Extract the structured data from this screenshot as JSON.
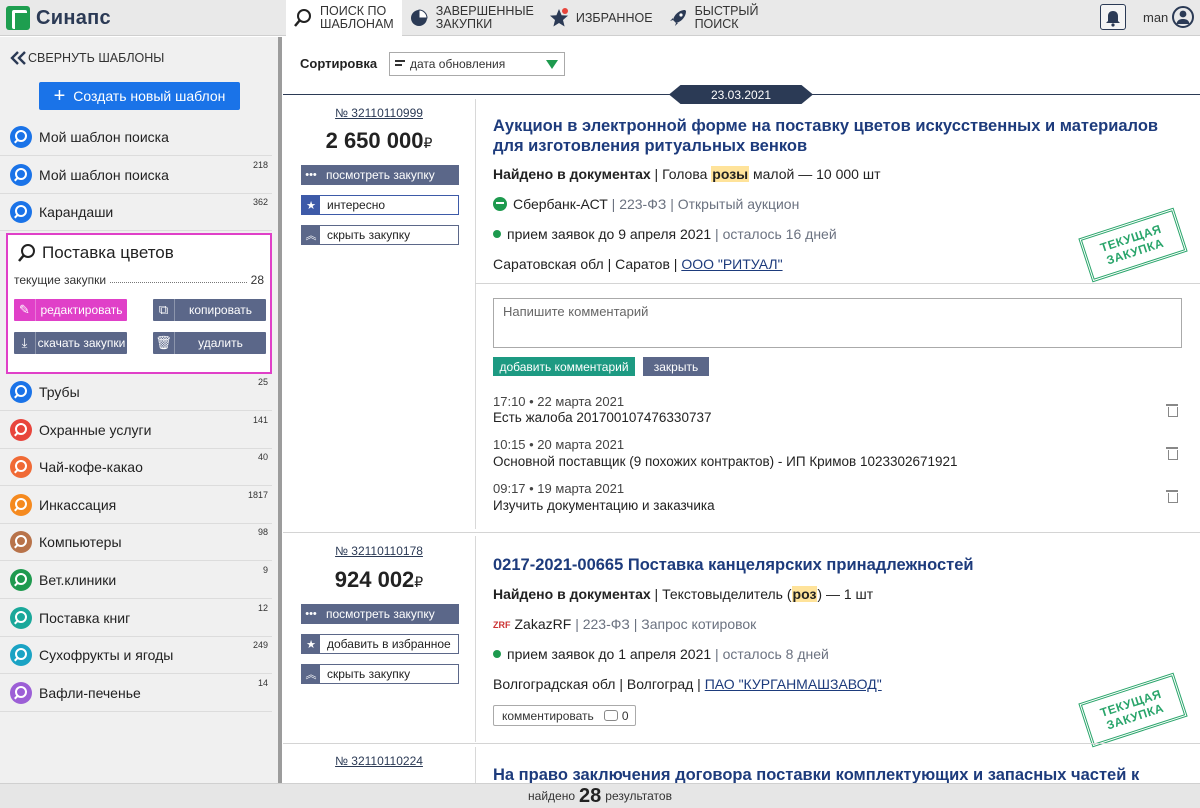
{
  "app": {
    "name": "Синапс",
    "user": "man"
  },
  "nav": [
    {
      "label": "Поиск по\nшаблонам",
      "icon": "search-icon"
    },
    {
      "label": "Завершенные\nзакупки",
      "icon": "pie-chart-icon"
    },
    {
      "label": "Избранное",
      "icon": "star-icon"
    },
    {
      "label": "Быстрый\nпоиск",
      "icon": "rocket-icon"
    }
  ],
  "sidebar": {
    "collapse_label": "СВЕРНУТЬ ШАБЛОНЫ",
    "create_label": "Создать новый шаблон",
    "templates": [
      {
        "name": "Мой шаблон поиска",
        "count": "",
        "color": "#1a73e8"
      },
      {
        "name": "Мой шаблон поиска",
        "count": "218",
        "color": "#1a73e8"
      },
      {
        "name": "Карандаши",
        "count": "362",
        "color": "#1a73e8"
      }
    ],
    "selected": {
      "name": "Поставка цветов",
      "sub_label": "текущие закупки",
      "sub_count": "28",
      "edit": "редактировать",
      "copy": "копировать",
      "download": "скачать закупки",
      "delete": "удалить"
    },
    "templates_after": [
      {
        "name": "Трубы",
        "count": "25",
        "color": "#1a73e8"
      },
      {
        "name": "Охранные услуги",
        "count": "141",
        "color": "#e8453c"
      },
      {
        "name": "Чай-кофе-какао",
        "count": "40",
        "color": "#f06a35"
      },
      {
        "name": "Инкассация",
        "count": "1817",
        "color": "#f58a1f"
      },
      {
        "name": "Компьютеры",
        "count": "98",
        "color": "#b8734a"
      },
      {
        "name": "Вет.клиники",
        "count": "9",
        "color": "#1f9a4f"
      },
      {
        "name": "Поставка книг",
        "count": "12",
        "color": "#1aa89a"
      },
      {
        "name": "Сухофрукты и ягоды",
        "count": "249",
        "color": "#1aa3c4"
      },
      {
        "name": "Вафли-печенье",
        "count": "14",
        "color": "#9c5fd6"
      }
    ]
  },
  "sort": {
    "label": "Сортировка",
    "value": "дата обновления"
  },
  "date_badge": "23.03.2021",
  "cards": [
    {
      "reg": "№ 32110110999",
      "price": "2 650 000",
      "currency": "₽",
      "btn_view": "посмотреть закупку",
      "btn_fav": "интересно",
      "btn_hide": "скрыть закупку",
      "title": "Аукцион в электронной форме на поставку цветов искусственных и материалов для изготовления ритуальных венков",
      "found_label": "Найдено в документах",
      "found_pre": "Голова ",
      "found_hl": "розы",
      "found_post": " малой — 10 000 шт",
      "platform": "Сбербанк-АСТ",
      "law": "223-ФЗ",
      "proc": "Открытый аукцион",
      "deadline": "прием заявок до 9 апреля 2021",
      "left": "осталось 16 дней",
      "region": "Саратовская обл | Саратов | ",
      "customer": "ООО \"РИТУАЛ\"",
      "stamp": "ТЕКУЩАЯ ЗАКУПКА"
    },
    {
      "reg": "№ 32110110178",
      "price": "924 002",
      "currency": "₽",
      "btn_view": "посмотреть закупку",
      "btn_fav": "добавить в избранное",
      "btn_hide": "скрыть закупку",
      "title": "0217-2021-00665 Поставка канцелярских принадлежностей",
      "found_label": "Найдено в документах",
      "found_pre": "Текстовыделитель (",
      "found_hl": "роз",
      "found_post": ") — 1 шт",
      "platform": "ZakazRF",
      "law": "223-ФЗ",
      "proc": "Запрос котировок",
      "deadline": "прием заявок до 1 апреля 2021",
      "left": "осталось 8 дней",
      "region": "Волгоградская обл | Волгоград | ",
      "customer": "ПАО \"КУРГАНМАШЗАВОД\"",
      "stamp": "ТЕКУЩАЯ ЗАКУПКА",
      "comment_btn": "комментировать",
      "comment_count": "0"
    },
    {
      "reg": "№ 32110110224",
      "title": "На право заключения договора поставки комплектующих и запасных частей к"
    }
  ],
  "comments": {
    "placeholder": "Напишите комментарий",
    "add": "добавить комментарий",
    "close": "закрыть",
    "items": [
      {
        "time": "17:10 • 22 марта 2021",
        "text": "Есть жалоба 201700107476330737"
      },
      {
        "time": "10:15 • 20 марта 2021",
        "text": "Основной поставщик (9 похожих контрактов) - ИП Кримов 1023302671921"
      },
      {
        "time": "09:17 • 19 марта 2021",
        "text": "Изучить документацию и заказчика"
      }
    ]
  },
  "footer": {
    "pre": "найдено",
    "count": "28",
    "post": "результатов"
  }
}
